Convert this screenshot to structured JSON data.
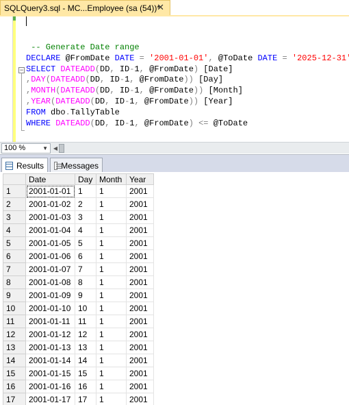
{
  "tab": {
    "title": "SQLQuery3.sql - MC...Employee (sa (54))*",
    "close_glyph": "✕"
  },
  "editor": {
    "lines": [
      [
        {
          "t": " -- Generate Date range",
          "c": "cm"
        }
      ],
      [
        {
          "t": "DECLARE ",
          "c": "kw"
        },
        {
          "t": "@FromDate ",
          "c": "tx"
        },
        {
          "t": "DATE ",
          "c": "kw"
        },
        {
          "t": "= ",
          "c": "op"
        },
        {
          "t": "'2001-01-01'",
          "c": "str"
        },
        {
          "t": ", ",
          "c": "op"
        },
        {
          "t": "@ToDate ",
          "c": "tx"
        },
        {
          "t": "DATE ",
          "c": "kw"
        },
        {
          "t": "= ",
          "c": "op"
        },
        {
          "t": "'2025-12-31'",
          "c": "str"
        }
      ],
      [
        {
          "t": "SELECT ",
          "c": "kw"
        },
        {
          "t": "DATEADD",
          "c": "fn"
        },
        {
          "t": "(",
          "c": "op"
        },
        {
          "t": "DD",
          "c": "tx"
        },
        {
          "t": ", ",
          "c": "op"
        },
        {
          "t": "ID",
          "c": "tx"
        },
        {
          "t": "-",
          "c": "op"
        },
        {
          "t": "1",
          "c": "tx"
        },
        {
          "t": ", ",
          "c": "op"
        },
        {
          "t": "@FromDate",
          "c": "tx"
        },
        {
          "t": ") ",
          "c": "op"
        },
        {
          "t": "[Date]",
          "c": "tx"
        }
      ],
      [
        {
          "t": ",",
          "c": "op"
        },
        {
          "t": "DAY",
          "c": "fn"
        },
        {
          "t": "(",
          "c": "op"
        },
        {
          "t": "DATEADD",
          "c": "fn"
        },
        {
          "t": "(",
          "c": "op"
        },
        {
          "t": "DD",
          "c": "tx"
        },
        {
          "t": ", ",
          "c": "op"
        },
        {
          "t": "ID",
          "c": "tx"
        },
        {
          "t": "-",
          "c": "op"
        },
        {
          "t": "1",
          "c": "tx"
        },
        {
          "t": ", ",
          "c": "op"
        },
        {
          "t": "@FromDate",
          "c": "tx"
        },
        {
          "t": ")) ",
          "c": "op"
        },
        {
          "t": "[Day]",
          "c": "tx"
        }
      ],
      [
        {
          "t": ",",
          "c": "op"
        },
        {
          "t": "MONTH",
          "c": "fn"
        },
        {
          "t": "(",
          "c": "op"
        },
        {
          "t": "DATEADD",
          "c": "fn"
        },
        {
          "t": "(",
          "c": "op"
        },
        {
          "t": "DD",
          "c": "tx"
        },
        {
          "t": ", ",
          "c": "op"
        },
        {
          "t": "ID",
          "c": "tx"
        },
        {
          "t": "-",
          "c": "op"
        },
        {
          "t": "1",
          "c": "tx"
        },
        {
          "t": ", ",
          "c": "op"
        },
        {
          "t": "@FromDate",
          "c": "tx"
        },
        {
          "t": ")) ",
          "c": "op"
        },
        {
          "t": "[Month]",
          "c": "tx"
        }
      ],
      [
        {
          "t": ",",
          "c": "op"
        },
        {
          "t": "YEAR",
          "c": "fn"
        },
        {
          "t": "(",
          "c": "op"
        },
        {
          "t": "DATEADD",
          "c": "fn"
        },
        {
          "t": "(",
          "c": "op"
        },
        {
          "t": "DD",
          "c": "tx"
        },
        {
          "t": ", ",
          "c": "op"
        },
        {
          "t": "ID",
          "c": "tx"
        },
        {
          "t": "-",
          "c": "op"
        },
        {
          "t": "1",
          "c": "tx"
        },
        {
          "t": ", ",
          "c": "op"
        },
        {
          "t": "@FromDate",
          "c": "tx"
        },
        {
          "t": ")) ",
          "c": "op"
        },
        {
          "t": "[Year]",
          "c": "tx"
        }
      ],
      [
        {
          "t": "FROM ",
          "c": "kw"
        },
        {
          "t": "dbo",
          "c": "tx"
        },
        {
          "t": ".",
          "c": "op"
        },
        {
          "t": "TallyTable",
          "c": "tx"
        }
      ],
      [
        {
          "t": "WHERE ",
          "c": "kw"
        },
        {
          "t": "DATEADD",
          "c": "fn"
        },
        {
          "t": "(",
          "c": "op"
        },
        {
          "t": "DD",
          "c": "tx"
        },
        {
          "t": ", ",
          "c": "op"
        },
        {
          "t": "ID",
          "c": "tx"
        },
        {
          "t": "-",
          "c": "op"
        },
        {
          "t": "1",
          "c": "tx"
        },
        {
          "t": ", ",
          "c": "op"
        },
        {
          "t": "@FromDate",
          "c": "tx"
        },
        {
          "t": ") ",
          "c": "op"
        },
        {
          "t": "<= ",
          "c": "op"
        },
        {
          "t": "@ToDate",
          "c": "tx"
        }
      ]
    ]
  },
  "zoom": {
    "value": "100 %"
  },
  "results_tabs": {
    "results_label": "Results",
    "messages_label": "Messages"
  },
  "grid": {
    "columns": [
      "Date",
      "Day",
      "Month",
      "Year"
    ],
    "rows": [
      [
        "1",
        "2001-01-01",
        "1",
        "1",
        "2001"
      ],
      [
        "2",
        "2001-01-02",
        "2",
        "1",
        "2001"
      ],
      [
        "3",
        "2001-01-03",
        "3",
        "1",
        "2001"
      ],
      [
        "4",
        "2001-01-04",
        "4",
        "1",
        "2001"
      ],
      [
        "5",
        "2001-01-05",
        "5",
        "1",
        "2001"
      ],
      [
        "6",
        "2001-01-06",
        "6",
        "1",
        "2001"
      ],
      [
        "7",
        "2001-01-07",
        "7",
        "1",
        "2001"
      ],
      [
        "8",
        "2001-01-08",
        "8",
        "1",
        "2001"
      ],
      [
        "9",
        "2001-01-09",
        "9",
        "1",
        "2001"
      ],
      [
        "10",
        "2001-01-10",
        "10",
        "1",
        "2001"
      ],
      [
        "11",
        "2001-01-11",
        "11",
        "1",
        "2001"
      ],
      [
        "12",
        "2001-01-12",
        "12",
        "1",
        "2001"
      ],
      [
        "13",
        "2001-01-13",
        "13",
        "1",
        "2001"
      ],
      [
        "14",
        "2001-01-14",
        "14",
        "1",
        "2001"
      ],
      [
        "15",
        "2001-01-15",
        "15",
        "1",
        "2001"
      ],
      [
        "16",
        "2001-01-16",
        "16",
        "1",
        "2001"
      ],
      [
        "17",
        "2001-01-17",
        "17",
        "1",
        "2001"
      ]
    ]
  }
}
